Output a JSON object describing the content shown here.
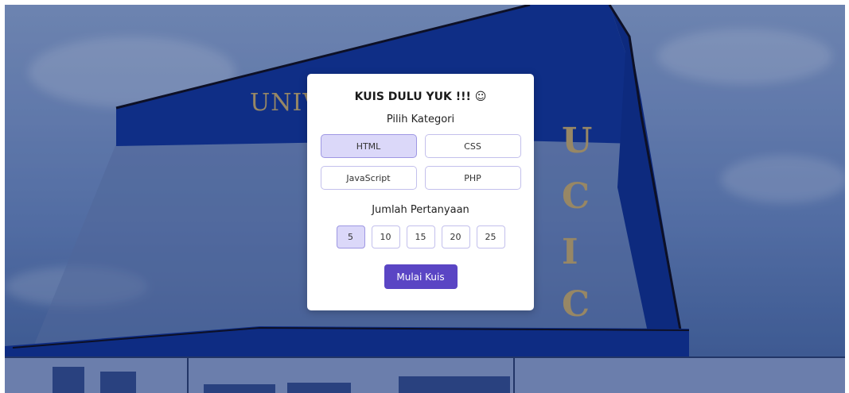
{
  "background": {
    "building_sign": "UNIV",
    "side_letters": [
      "U",
      "C",
      "I",
      "C"
    ],
    "colors": {
      "building_blue": "#0d2f8f",
      "gold": "#b29b67"
    }
  },
  "quiz": {
    "title": "KUIS DULU YUK !!! ☺",
    "category_heading": "Pilih Kategori",
    "categories": [
      {
        "label": "HTML",
        "selected": true
      },
      {
        "label": "CSS",
        "selected": false
      },
      {
        "label": "JavaScript",
        "selected": false
      },
      {
        "label": "PHP",
        "selected": false
      }
    ],
    "count_heading": "Jumlah Pertanyaan",
    "counts": [
      {
        "label": "5",
        "selected": true
      },
      {
        "label": "10",
        "selected": false
      },
      {
        "label": "15",
        "selected": false
      },
      {
        "label": "20",
        "selected": false
      },
      {
        "label": "25",
        "selected": false
      }
    ],
    "start_label": "Mulai Kuis",
    "colors": {
      "accent": "#5a45c4",
      "selected_bg": "#dbd8f9",
      "border": "#c3c0ec"
    }
  }
}
